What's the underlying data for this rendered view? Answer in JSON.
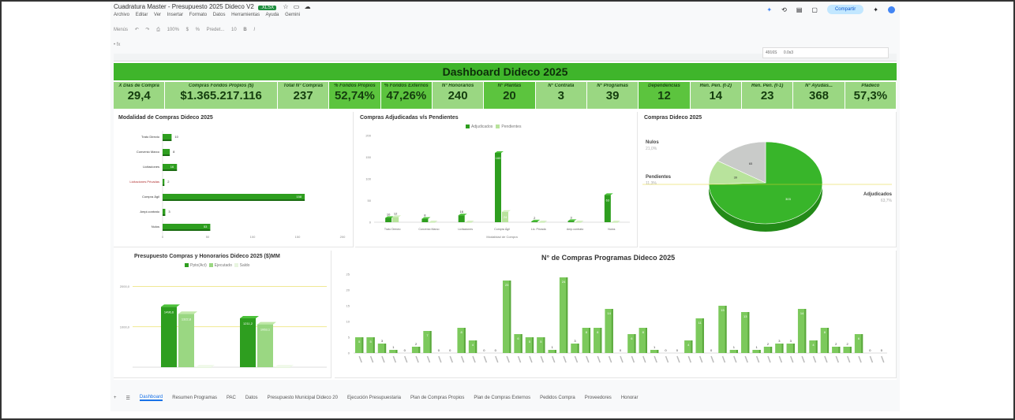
{
  "window": {
    "title": "Cuadratura Master - Presupuesto 2025 Dideco V2",
    "format_badge": ".XLSX",
    "share_label": "Compartir"
  },
  "menu": [
    "Archivo",
    "Editar",
    "Ver",
    "Insertar",
    "Formato",
    "Datos",
    "Herramientas",
    "Ayuda",
    "Gemini"
  ],
  "toolbar": [
    "Menús",
    "100%",
    "$",
    "%",
    "Predet...",
    "10",
    "B",
    "I"
  ],
  "cell_ref": {
    "cell": "4916S",
    "value": "0.0s3"
  },
  "dashboard": {
    "title": "Dashboard Dideco 2025",
    "kpis": [
      {
        "label": "X̄ Días de Compra",
        "value": "29,4"
      },
      {
        "label": "Compras Fondos Propios ($)",
        "value": "$1.365.217.116"
      },
      {
        "label": "Total N° Compras",
        "value": "237"
      },
      {
        "label": "% Fondos Propios",
        "value": "52,74%"
      },
      {
        "label": "% Fondos Externos",
        "value": "47,26%"
      },
      {
        "label": "N° Honorarios",
        "value": "240"
      },
      {
        "label": "N° Plantas",
        "value": "20"
      },
      {
        "label": "N° Contrata",
        "value": "3"
      },
      {
        "label": "N° Programas",
        "value": "39"
      },
      {
        "label": "Dependencias",
        "value": "12"
      },
      {
        "label": "Ren. Pen. (t-2)",
        "value": "14"
      },
      {
        "label": "Ren. Pen. (t-1)",
        "value": "23"
      },
      {
        "label": "N° Ayudas...",
        "value": "368"
      },
      {
        "label": "Pladeco",
        "value": "57,3%"
      }
    ]
  },
  "tabs": [
    "Dashboard",
    "Resumen Programas",
    "PAC",
    "Datos",
    "Presupuesto Municipal Dideco 20",
    "Ejecución Presupuestaria",
    "Plan de Compras Propios",
    "Plan de Compras Externos",
    "Pedidos Compra",
    "Proveedores",
    "Honorar"
  ],
  "chart_data": [
    {
      "type": "bar",
      "title": "Modalidad de Compras Dideco 2025",
      "orientation": "horizontal",
      "categories": [
        "Trato Directo",
        "Convenio Marco",
        "Licitaciones",
        "Licitaciones Privadas",
        "Compra Ágil",
        "Ampi.contrato",
        "Nulos"
      ],
      "values": [
        10,
        8,
        16,
        2,
        158,
        3,
        53
      ],
      "xlim": [
        0,
        200
      ],
      "ticks": [
        "0",
        "50",
        "100",
        "150",
        "200"
      ]
    },
    {
      "type": "bar",
      "title": "Compras Adjudicadas v/s Pendientes",
      "categories": [
        "Trato Directo",
        "Convenio Marco",
        "Licitaciones",
        "Compra Ágil",
        "Lic. Privada",
        "Amp.contrato",
        "Nulos"
      ],
      "series": [
        {
          "name": "Adjudicados",
          "values": [
            10,
            8,
            16,
            160,
            2,
            3,
            63
          ]
        },
        {
          "name": "Pendientes",
          "values": [
            12,
            0,
            0,
            24,
            0,
            0,
            0
          ]
        }
      ],
      "xlabel": "Modalidad de Compra",
      "ylim": [
        0,
        200
      ],
      "ticks": [
        "0",
        "50",
        "100",
        "150",
        "200"
      ]
    },
    {
      "type": "pie",
      "title": "Compras Dideco 2025",
      "slices": [
        {
          "label": "Adjudicados",
          "pct": "63,7%",
          "value": 303
        },
        {
          "label": "Pendientes",
          "pct": "11,3%",
          "value": 39
        },
        {
          "label": "Nulos",
          "pct": "21,0%",
          "value": 65
        }
      ]
    },
    {
      "type": "bar",
      "title": "Presupuesto Compras y Honorarios Dideco 2025 ($)MM",
      "categories": [
        "Compras",
        "Honorarios"
      ],
      "series": [
        {
          "name": "Ppto(Act)",
          "values": [
            1496.6,
            1211.2
          ]
        },
        {
          "name": "Ejecutado",
          "values": [
            1322.8,
            1063.1
          ]
        },
        {
          "name": "Saldo",
          "values": [
            0,
            0
          ]
        }
      ],
      "ticks": [
        "1000,0",
        "2000,0"
      ]
    },
    {
      "type": "bar",
      "title": "N° de Compras Programas Dideco 2025",
      "values": [
        5,
        5,
        3,
        1,
        0,
        2,
        7,
        0,
        0,
        8,
        4,
        0,
        0,
        23,
        6,
        5,
        5,
        1,
        24,
        3,
        8,
        8,
        14,
        0,
        6,
        8,
        1,
        0,
        0,
        4,
        11,
        0,
        15,
        1,
        13,
        1,
        2,
        3,
        3,
        14,
        4,
        8,
        2,
        2,
        6,
        0,
        0
      ],
      "ylim": [
        0,
        25
      ],
      "ticks": [
        "0",
        "5",
        "10",
        "15",
        "20",
        "25"
      ]
    }
  ]
}
